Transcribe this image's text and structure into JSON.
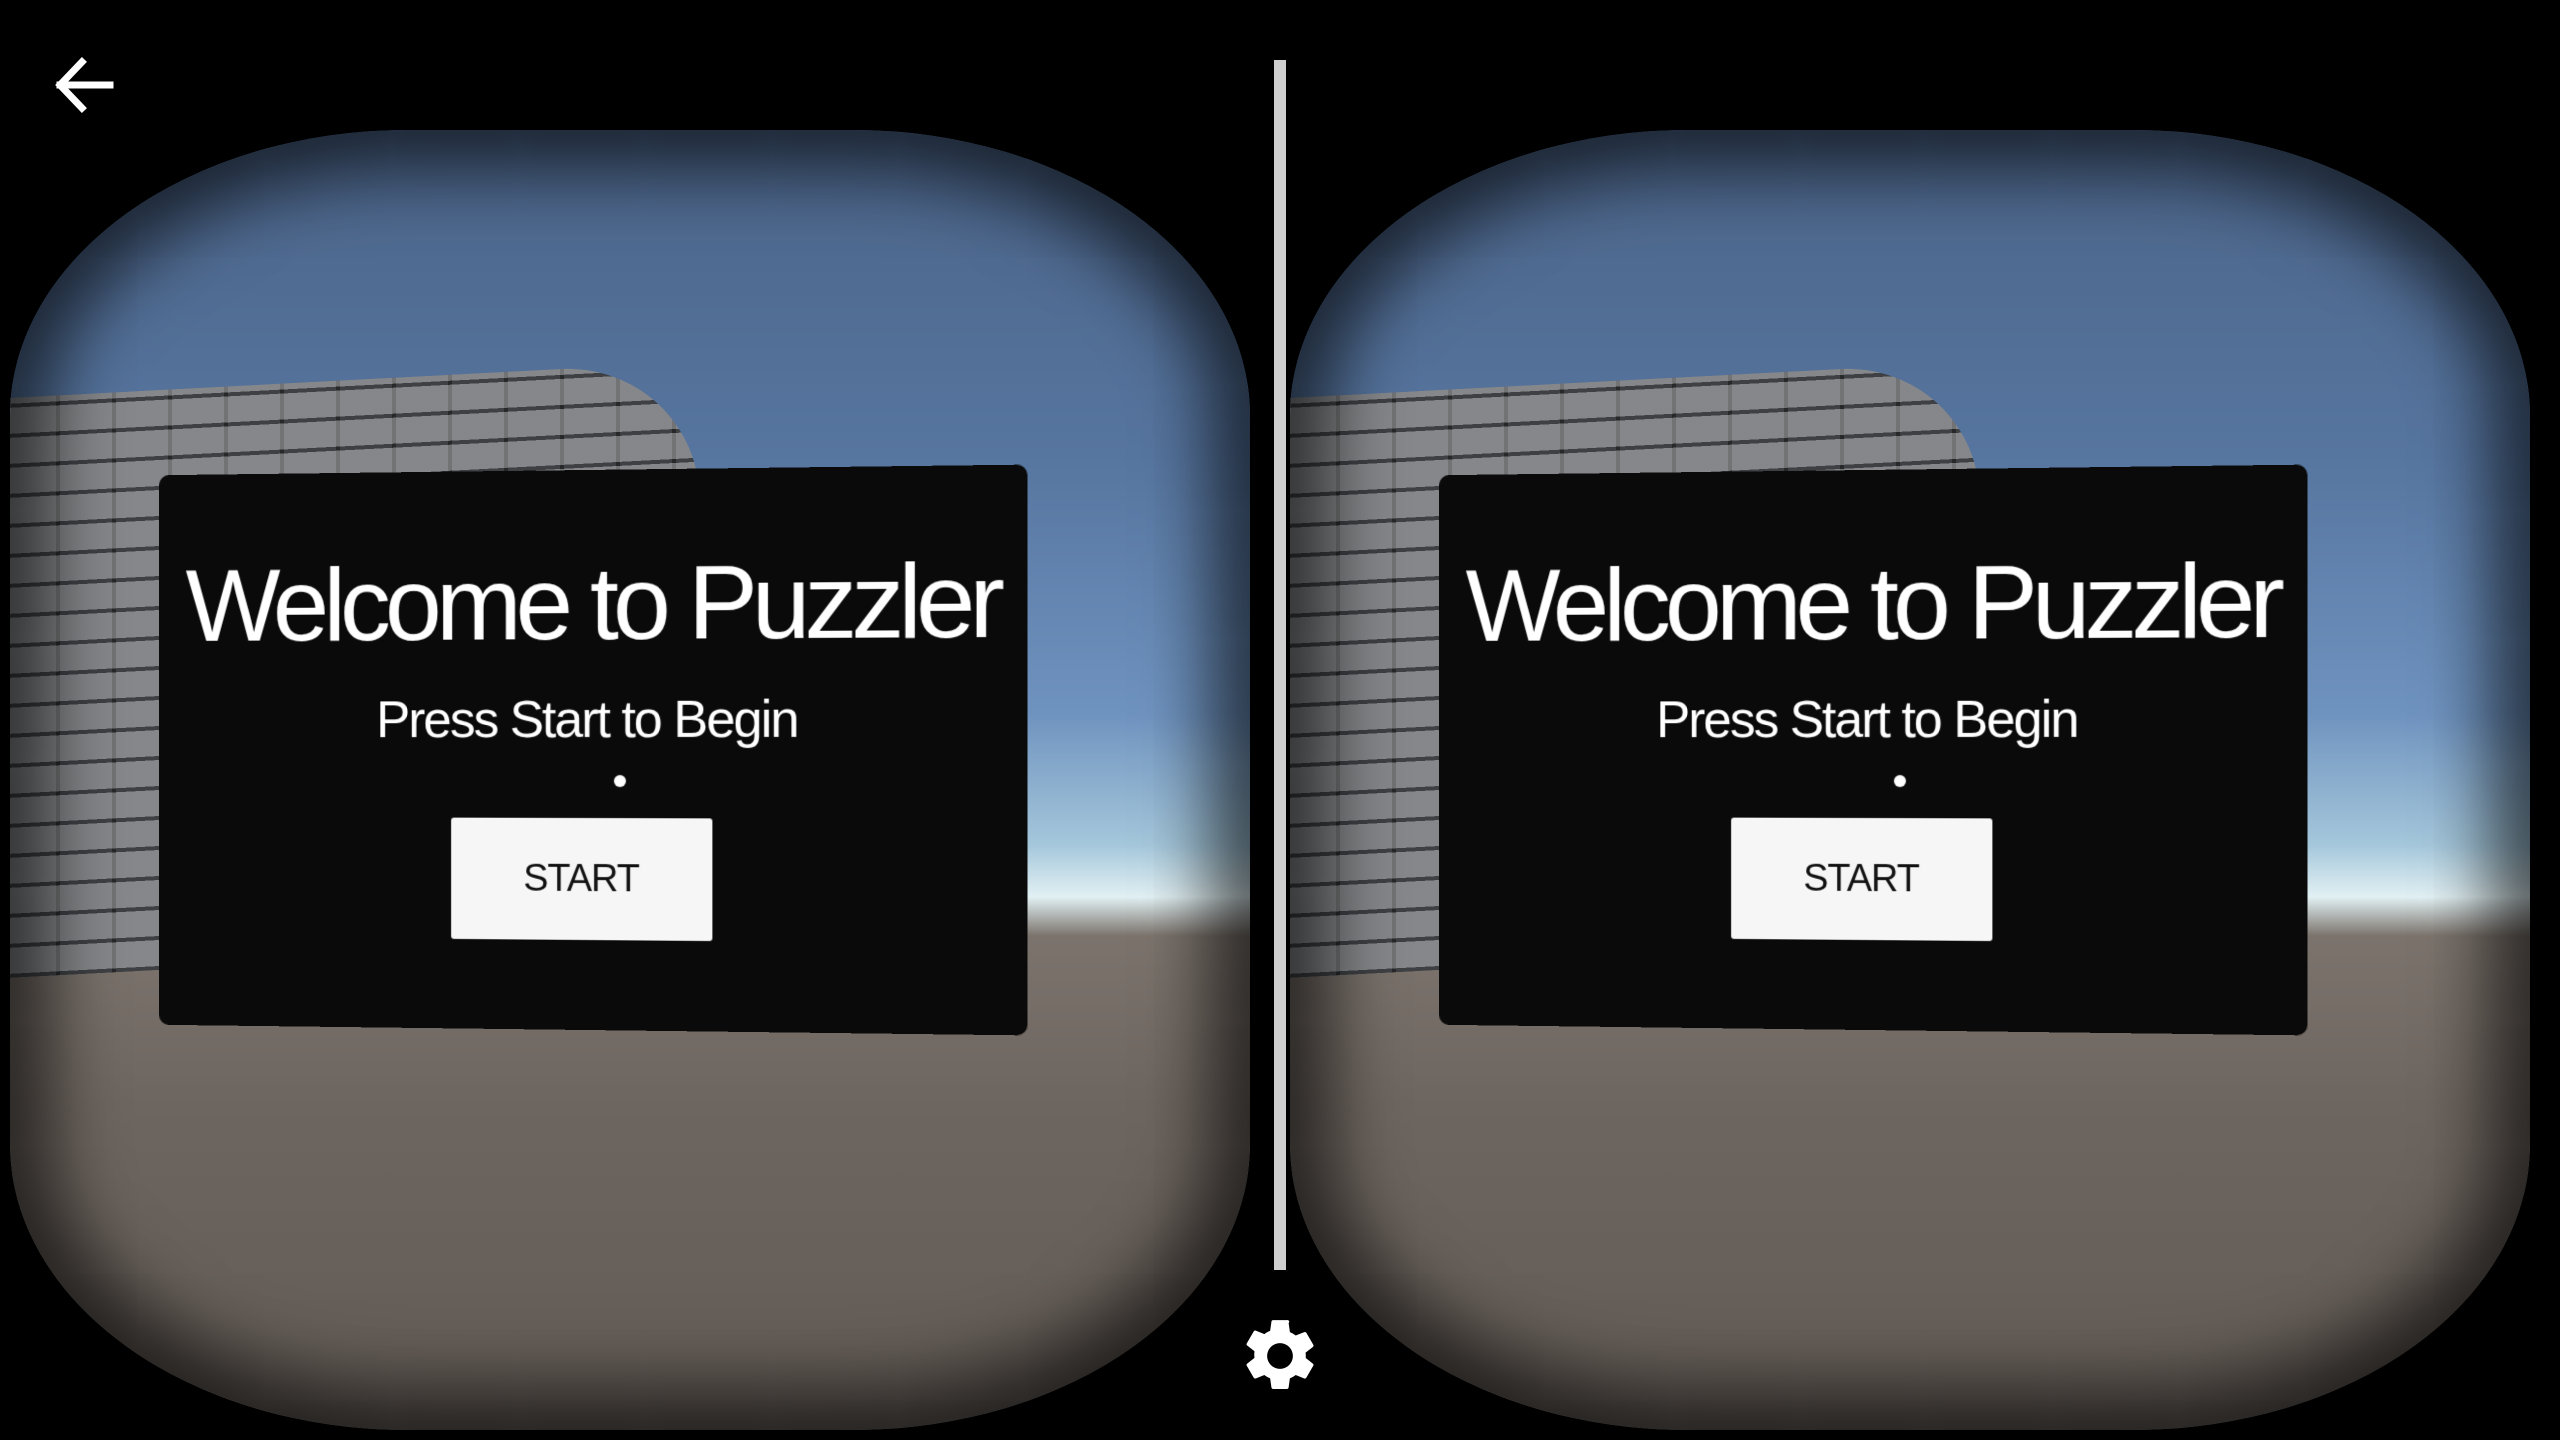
{
  "nav": {
    "back_icon": "back-arrow-icon",
    "settings_icon": "gear-icon"
  },
  "left_eye": {
    "title": "Welcome to Puzzler",
    "subtitle": "Press Start to Begin",
    "start_label": "START"
  },
  "right_eye": {
    "title": "Welcome to Puzzler",
    "subtitle": "Press Start to Begin",
    "start_label": "START"
  },
  "colors": {
    "background": "#000000",
    "panel": "#0a0a0a",
    "button": "#f6f6f6",
    "divider": "#cfcfcf",
    "sky": "#56759f",
    "ground": "#6d655f"
  }
}
